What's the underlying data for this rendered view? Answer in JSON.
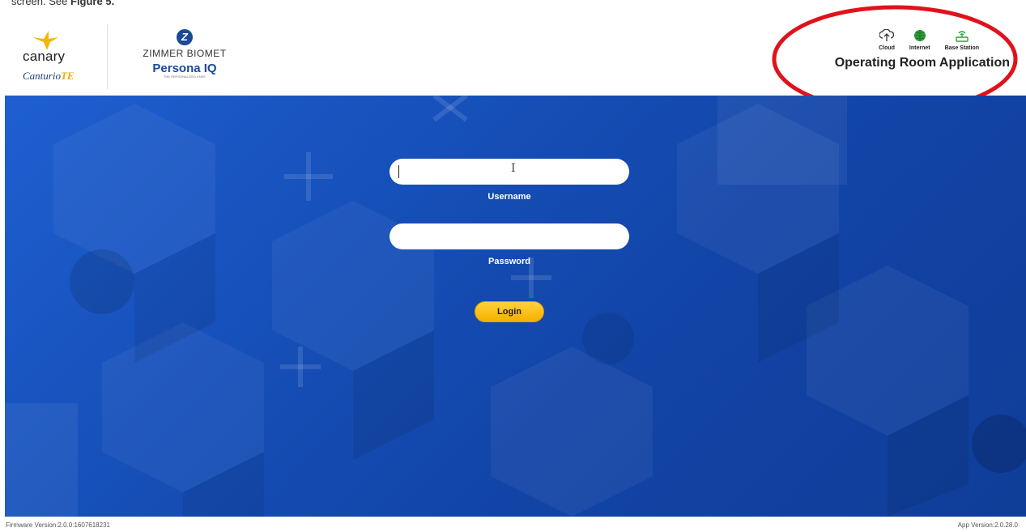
{
  "caption": {
    "prefix": "screen. See",
    "figure_ref": "Figure 5."
  },
  "header": {
    "canary_word": "canary",
    "canturio_main": "Canturio",
    "canturio_suffix": "TE",
    "zimmer_word": "ZIMMER BIOMET",
    "persona_main": "Persona",
    "persona_iq": "IQ",
    "persona_tagline": "THE PERSONALIZED KNEE"
  },
  "status": {
    "items": [
      {
        "label": "Cloud",
        "icon": "cloud-upload-icon"
      },
      {
        "label": "Internet",
        "icon": "globe-icon",
        "color": "#2e9e3a"
      },
      {
        "label": "Base Station",
        "icon": "router-icon",
        "color": "#2e9e3a"
      }
    ],
    "app_title": "Operating Room Application"
  },
  "annotation": {
    "color": "#e0121b"
  },
  "login": {
    "username_value": "",
    "username_label": "Username",
    "password_value": "",
    "password_label": "Password",
    "button_label": "Login"
  },
  "footer": {
    "firmware": "Firmware Version:2.0.0:1607618231",
    "app_version": "App Version:2.0.28.0"
  },
  "colors": {
    "background_blue": "#1a55c4",
    "button_yellow": "#f5b000"
  }
}
